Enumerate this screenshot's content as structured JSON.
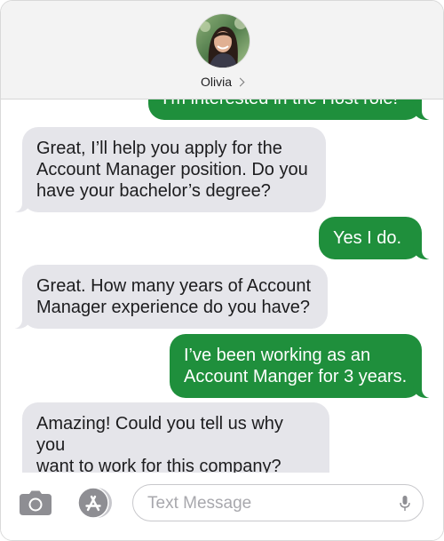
{
  "contact": {
    "name": "Olivia"
  },
  "messages": [
    {
      "from": "me",
      "lines": [
        "I'm interested in the Host role!"
      ]
    },
    {
      "from": "them",
      "lines": [
        "Great, I’ll help you apply for the",
        "Account Manager position. Do you",
        "have your bachelor’s degree?"
      ]
    },
    {
      "from": "me",
      "lines": [
        "Yes I do."
      ]
    },
    {
      "from": "them",
      "lines": [
        "Great. How many years of Account",
        "Manager experience do you have?"
      ]
    },
    {
      "from": "me",
      "lines": [
        "I’ve been working as an",
        "Account Manger for 3 years."
      ]
    },
    {
      "from": "them",
      "lines": [
        "Amazing! Could you tell us why you",
        "want to work for this company?"
      ]
    }
  ],
  "composer": {
    "placeholder": "Text Message",
    "value": ""
  },
  "colors": {
    "outgoing": "#1f8f3c",
    "incoming": "#e5e5ea",
    "header": "#f3f3f3"
  }
}
